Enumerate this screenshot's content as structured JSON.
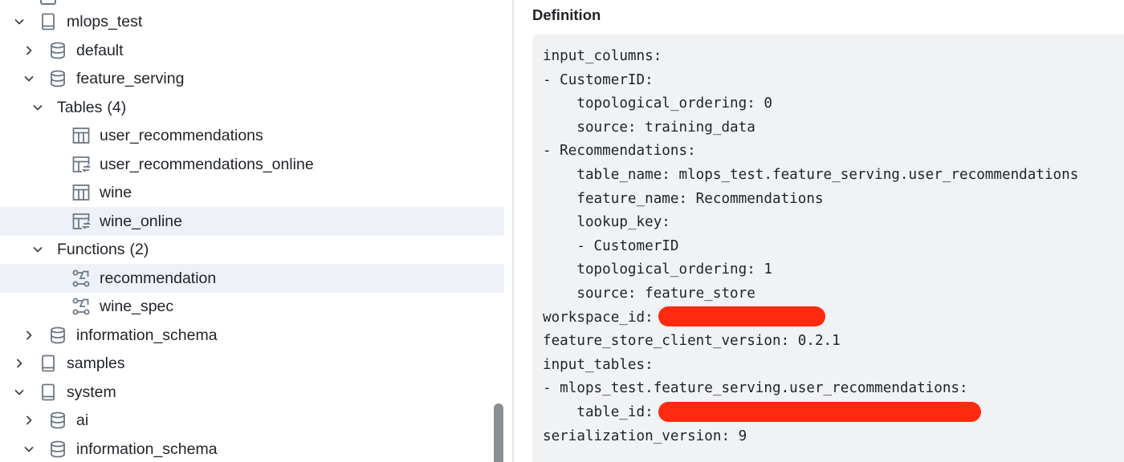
{
  "tree": {
    "items": [
      {
        "label": "mlops_test",
        "count": "",
        "icon": "catalog-icon",
        "expanded": true,
        "has_chevron": true
      },
      {
        "label": "default",
        "count": "",
        "icon": "schema-icon",
        "expanded": false,
        "has_chevron": true
      },
      {
        "label": "feature_serving",
        "count": "",
        "icon": "schema-icon",
        "expanded": true,
        "has_chevron": true
      },
      {
        "label": "Tables",
        "count": "(4)",
        "icon": "",
        "expanded": true,
        "has_chevron": true
      },
      {
        "label": "user_recommendations",
        "count": "",
        "icon": "table-icon",
        "has_chevron": false
      },
      {
        "label": "user_recommendations_online",
        "count": "",
        "icon": "online-table-icon",
        "has_chevron": false
      },
      {
        "label": "wine",
        "count": "",
        "icon": "table-icon",
        "has_chevron": false
      },
      {
        "label": "wine_online",
        "count": "",
        "icon": "online-table-icon",
        "has_chevron": false,
        "selected": true
      },
      {
        "label": "Functions",
        "count": "(2)",
        "icon": "",
        "expanded": true,
        "has_chevron": true
      },
      {
        "label": "recommendation",
        "count": "",
        "icon": "function-icon",
        "has_chevron": false,
        "selected": true
      },
      {
        "label": "wine_spec",
        "count": "",
        "icon": "function-icon",
        "has_chevron": false
      },
      {
        "label": "information_schema",
        "count": "",
        "icon": "schema-icon",
        "expanded": false,
        "has_chevron": true
      },
      {
        "label": "samples",
        "count": "",
        "icon": "catalog-icon",
        "expanded": false,
        "has_chevron": true
      },
      {
        "label": "system",
        "count": "",
        "icon": "catalog-icon",
        "expanded": true,
        "has_chevron": true
      },
      {
        "label": "ai",
        "count": "",
        "icon": "schema-icon",
        "expanded": false,
        "has_chevron": true
      },
      {
        "label": "information_schema",
        "count": "",
        "icon": "schema-icon",
        "expanded": true,
        "has_chevron": true
      }
    ]
  },
  "definition": {
    "title": "Definition",
    "lines": [
      {
        "text": "input_columns:"
      },
      {
        "text": "- CustomerID:"
      },
      {
        "text": "    topological_ordering: 0"
      },
      {
        "text": "    source: training_data"
      },
      {
        "text": "- Recommendations:"
      },
      {
        "text": "    table_name: mlops_test.feature_serving.user_recommendations"
      },
      {
        "text": "    feature_name: Recommendations"
      },
      {
        "text": "    lookup_key:"
      },
      {
        "text": "    - CustomerID"
      },
      {
        "text": "    topological_ordering: 1"
      },
      {
        "text": "    source: feature_store"
      },
      {
        "text": "workspace_id:",
        "redacted": "short"
      },
      {
        "text": "feature_store_client_version: 0.2.1"
      },
      {
        "text": "input_tables:"
      },
      {
        "text": "- mlops_test.feature_serving.user_recommendations:"
      },
      {
        "text": "    table_id:",
        "redacted": "long"
      },
      {
        "text": "serialization_version: 9"
      }
    ]
  },
  "colors": {
    "selected_row": "#eef2f8",
    "code_background": "#f1f2f3",
    "redaction": "#ff2a0f",
    "icon_stroke": "#6b7785"
  }
}
